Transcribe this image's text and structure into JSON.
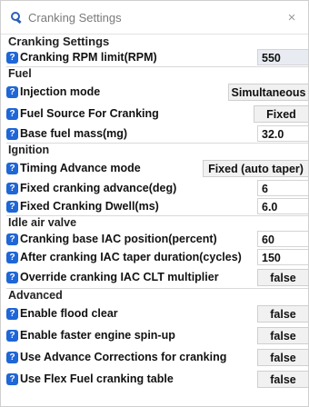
{
  "window": {
    "title": "Cranking Settings",
    "close_glyph": "×",
    "icon": "gear-wrench-icon"
  },
  "cranking": {
    "title": "Cranking Settings",
    "rpm_limit": {
      "label": "Cranking RPM limit(RPM)",
      "value": "550"
    }
  },
  "fuel": {
    "title": "Fuel",
    "injection_mode": {
      "label": "Injection mode",
      "value": "Simultaneous"
    },
    "fuel_source": {
      "label": "Fuel Source For Cranking",
      "value": "Fixed"
    },
    "base_fuel_mass": {
      "label": "Base fuel mass(mg)",
      "value": "32.0"
    }
  },
  "ignition": {
    "title": "Ignition",
    "timing_mode": {
      "label": "Timing Advance mode",
      "value": "Fixed (auto taper)"
    },
    "fixed_advance": {
      "label": "Fixed cranking advance(deg)",
      "value": "6"
    },
    "fixed_dwell": {
      "label": "Fixed Cranking Dwell(ms)",
      "value": "6.0"
    }
  },
  "iac": {
    "title": "Idle air valve",
    "base_position": {
      "label": "Cranking base IAC position(percent)",
      "value": "60"
    },
    "taper_duration": {
      "label": "After cranking IAC taper duration(cycles)",
      "value": "150"
    },
    "override_clt": {
      "label": "Override cranking IAC CLT multiplier",
      "value": "false"
    }
  },
  "advanced": {
    "title": "Advanced",
    "flood_clear": {
      "label": "Enable flood clear",
      "value": "false"
    },
    "faster_spinup": {
      "label": "Enable faster engine spin-up",
      "value": "false"
    },
    "advance_corrections": {
      "label": "Use Advance Corrections for cranking",
      "value": "false"
    },
    "flex_fuel": {
      "label": "Use Flex Fuel cranking table",
      "value": "false"
    }
  },
  "help_glyph": "?"
}
